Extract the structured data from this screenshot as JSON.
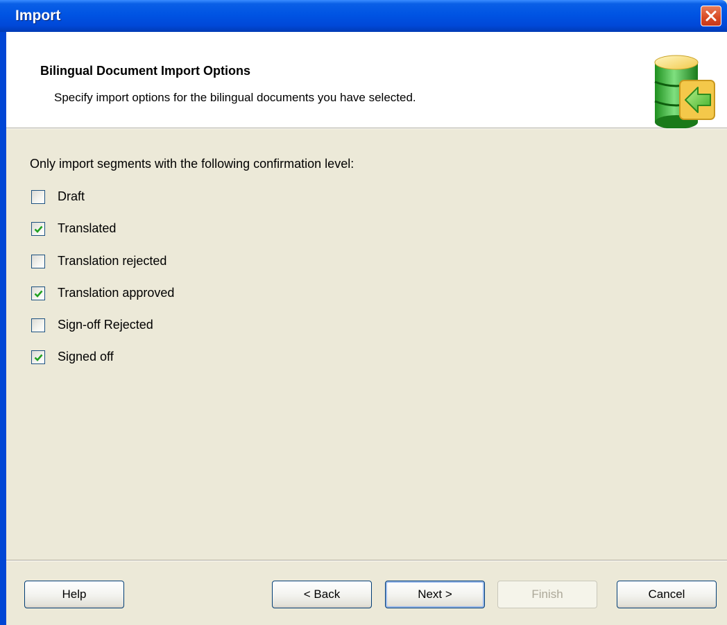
{
  "window": {
    "title": "Import"
  },
  "header": {
    "title": "Bilingual Document Import Options",
    "subtitle": "Specify import options for the bilingual documents you have selected."
  },
  "main": {
    "prompt": "Only import segments with the following confirmation level:",
    "options": [
      {
        "label": "Draft",
        "checked": false
      },
      {
        "label": "Translated",
        "checked": true
      },
      {
        "label": "Translation rejected",
        "checked": false
      },
      {
        "label": "Translation approved",
        "checked": true
      },
      {
        "label": "Sign-off Rejected",
        "checked": false
      },
      {
        "label": "Signed off",
        "checked": true
      }
    ]
  },
  "footer": {
    "help": "Help",
    "back": "< Back",
    "next": "Next >",
    "finish": "Finish",
    "finish_enabled": false,
    "cancel": "Cancel"
  },
  "icons": {
    "close": "close-icon",
    "header": "database-import-icon",
    "check": "checkmark-icon"
  },
  "colors": {
    "titlebar": "#0054E3",
    "dialog_bg": "#ECE9D8",
    "check": "#21A121",
    "close_button": "#D84A22"
  }
}
